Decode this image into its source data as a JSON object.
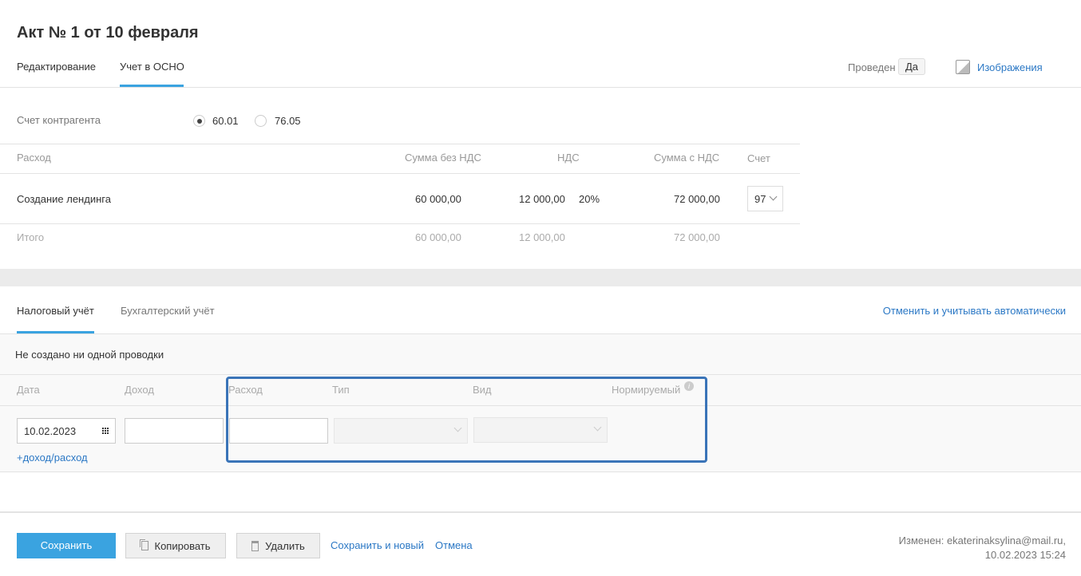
{
  "title": "Акт № 1 от 10 февраля",
  "tabs": [
    "Редактирование",
    "Учет в ОСНО"
  ],
  "status": {
    "label": "Проведен",
    "value": "Да"
  },
  "images_link": "Изображения",
  "counterparty": {
    "label": "Счет контрагента",
    "options": [
      "60.01",
      "76.05"
    ],
    "selected": "60.01"
  },
  "table": {
    "headers": [
      "Расход",
      "Сумма без НДС",
      "НДС",
      "Сумма с НДС",
      "Счет"
    ],
    "rows": [
      {
        "name": "Создание лендинга",
        "sum": "60 000,00",
        "vat": "12 000,00",
        "rate": "20%",
        "total": "72 000,00",
        "account": "97"
      }
    ],
    "total": {
      "label": "Итого",
      "sum": "60 000,00",
      "vat": "12 000,00",
      "total": "72 000,00"
    }
  },
  "subtabs": [
    "Налоговый учёт",
    "Бухгалтерский учёт"
  ],
  "auto_link": "Отменить и учитывать автоматически",
  "empty_msg": "Не создано ни одной проводки",
  "entries": {
    "headers": [
      "Дата",
      "Доход",
      "Расход",
      "Тип",
      "Вид",
      "Нормируемый"
    ],
    "date": "10.02.2023",
    "add_link": "+доход/расход"
  },
  "footer": {
    "save": "Сохранить",
    "copy": "Копировать",
    "delete": "Удалить",
    "save_new": "Сохранить и новый",
    "cancel": "Отмена",
    "modified": "Изменен: ekaterinaksylina@mail.ru,",
    "modified_date": "10.02.2023 15:24"
  },
  "colors": {
    "accent": "#3aa3e0",
    "link": "#2b78c5",
    "highlight": "#3a74b8"
  }
}
